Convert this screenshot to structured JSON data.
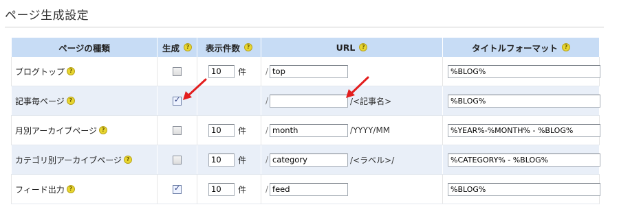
{
  "page_title": "ページ生成設定",
  "headers": {
    "type": "ページの種類",
    "generate": "生成",
    "count": "表示件数",
    "url": "URL",
    "title_format": "タイトルフォーマット"
  },
  "help_glyph": "?",
  "url_slash": "/",
  "rows": [
    {
      "label": "ブログトップ",
      "checked": false,
      "check_glyph": "",
      "count": "10",
      "unit": "件",
      "url": "top",
      "url_suffix": "",
      "title": "%BLOG%"
    },
    {
      "label": "記事毎ページ",
      "checked": true,
      "check_glyph": "✓",
      "count": "",
      "unit": "",
      "url": "",
      "url_suffix": "/<記事名>",
      "title": "%BLOG%"
    },
    {
      "label": "月別アーカイブページ",
      "checked": false,
      "check_glyph": "",
      "count": "10",
      "unit": "件",
      "url": "month",
      "url_suffix": "/YYYY/MM",
      "title": "%YEAR%-%MONTH% - %BLOG%"
    },
    {
      "label": "カテゴリ別アーカイブページ",
      "checked": false,
      "check_glyph": "",
      "count": "10",
      "unit": "件",
      "url": "category",
      "url_suffix": "/<ラベル>/",
      "title": "%CATEGORY% - %BLOG%"
    },
    {
      "label": "フィード出力",
      "checked": true,
      "check_glyph": "✓",
      "count": "10",
      "unit": "件",
      "url": "feed",
      "url_suffix": "",
      "title": "%BLOG%"
    }
  ],
  "colors": {
    "header_bg": "#c7dcf5",
    "alt_row_bg": "#e9eff8",
    "help_icon": "#e8d630",
    "annotation_arrow": "#e31e1e"
  },
  "icons": [
    "help-icon",
    "checkbox",
    "annotation-arrow"
  ]
}
